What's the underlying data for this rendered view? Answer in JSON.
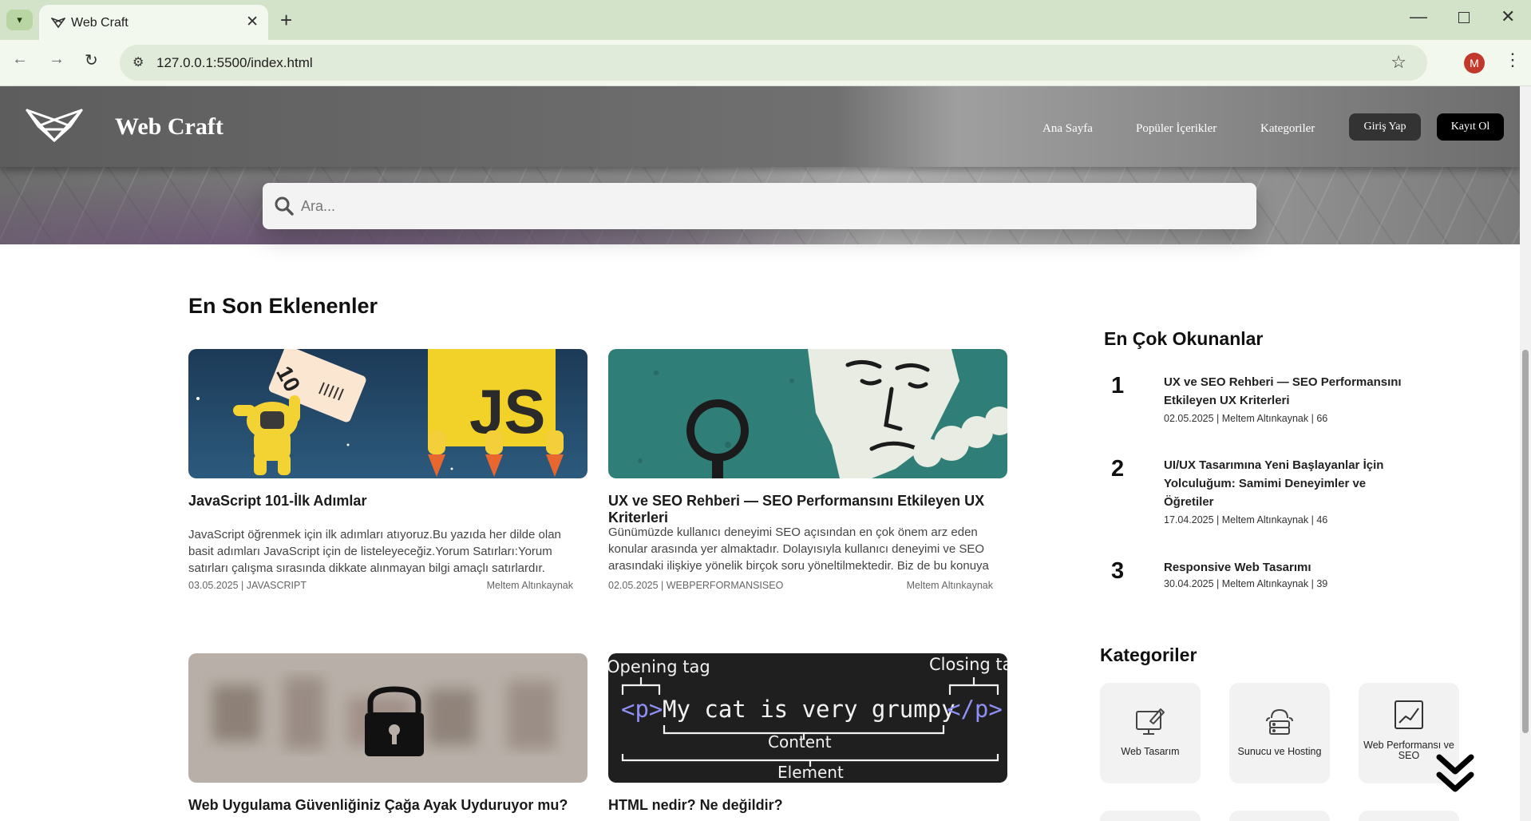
{
  "browser": {
    "tab_title": "Web Craft",
    "new_tab_glyph": "+",
    "url": "127.0.0.1:5500/index.html",
    "profile_initial": "M"
  },
  "header": {
    "brand": "Web Craft",
    "nav": [
      "Ana Sayfa",
      "Popüler İçerikler",
      "Kategoriler"
    ],
    "login_label": "Giriş Yap",
    "register_label": "Kayıt Ol"
  },
  "search": {
    "placeholder": "Ara..."
  },
  "latest": {
    "title": "En Son Eklenenler",
    "cards": [
      {
        "title": "JavaScript 101-İlk Adımlar",
        "excerpt": "JavaScript öğrenmek için ilk adımları atıyoruz.Bu yazıda her dilde olan basit adımları JavaScript için de listeleyeceğiz.Yorum Satırları:Yorum satırları çalışma sırasında dikkate alınmayan bilgi amaçlı satırlardır.",
        "meta": "03.05.2025 | JAVASCRIPT",
        "author": "Meltem Altınkaynak",
        "image_text": "JS",
        "image_number": "10"
      },
      {
        "title": "UX ve SEO Rehberi — SEO Performansını Etkileyen UX Kriterleri",
        "excerpt": "Günümüzde kullanıcı deneyimi SEO açısından en çok önem arz eden konular arasında yer almaktadır. Dolayısıyla kullanıcı deneyimi ve SEO arasındaki ilişkiye yönelik birçok soru yöneltilmektedir. Biz de bu konuya",
        "meta": "02.05.2025 | WEBPERFORMANSISEO",
        "author": "Meltem Altınkaynak"
      },
      {
        "title": "Web Uygulama Güvenliğiniz Çağa Ayak Uyduruyor mu?"
      },
      {
        "title": "HTML nedir? Ne değildir?",
        "diagram": {
          "opening": "Opening tag",
          "closing": "Closing tag",
          "open_tag": "<p>",
          "content_text": "My cat is very grumpy",
          "close_tag": "</p>",
          "content_label": "Content",
          "element_label": "Element"
        }
      }
    ]
  },
  "popular": {
    "title": "En Çok Okunanlar",
    "items": [
      {
        "rank": "1",
        "title": "UX ve SEO Rehberi — SEO Performansını Etkileyen UX Kriterleri",
        "meta": "02.05.2025 | Meltem Altınkaynak | 66"
      },
      {
        "rank": "2",
        "title": "UI/UX Tasarımına Yeni Başlayanlar İçin Yolculuğum: Samimi Deneyimler ve Öğretiler",
        "meta": "17.04.2025 | Meltem Altınkaynak | 46"
      },
      {
        "rank": "3",
        "title": "Responsive Web Tasarımı",
        "meta": "30.04.2025 | Meltem Altınkaynak | 39"
      }
    ]
  },
  "categories": {
    "title": "Kategoriler",
    "items": [
      {
        "label": "Web Tasarım",
        "icon": "monitor-pen-icon"
      },
      {
        "label": "Sunucu ve Hosting",
        "icon": "cloud-server-icon"
      },
      {
        "label": "Web Performansı ve SEO",
        "icon": "chart-line-icon"
      }
    ]
  }
}
